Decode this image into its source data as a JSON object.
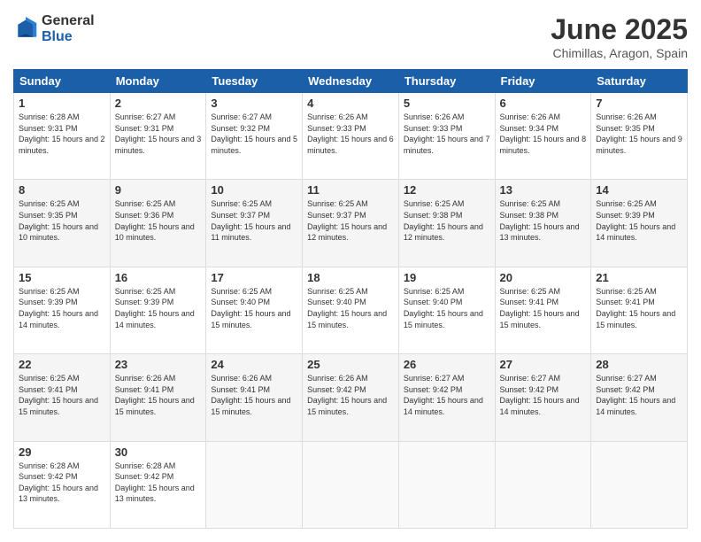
{
  "logo": {
    "general": "General",
    "blue": "Blue"
  },
  "title": "June 2025",
  "location": "Chimillas, Aragon, Spain",
  "days_of_week": [
    "Sunday",
    "Monday",
    "Tuesday",
    "Wednesday",
    "Thursday",
    "Friday",
    "Saturday"
  ],
  "weeks": [
    [
      {
        "day": "1",
        "sunrise": "6:28 AM",
        "sunset": "9:31 PM",
        "daylight": "15 hours and 2 minutes."
      },
      {
        "day": "2",
        "sunrise": "6:27 AM",
        "sunset": "9:31 PM",
        "daylight": "15 hours and 3 minutes."
      },
      {
        "day": "3",
        "sunrise": "6:27 AM",
        "sunset": "9:32 PM",
        "daylight": "15 hours and 5 minutes."
      },
      {
        "day": "4",
        "sunrise": "6:26 AM",
        "sunset": "9:33 PM",
        "daylight": "15 hours and 6 minutes."
      },
      {
        "day": "5",
        "sunrise": "6:26 AM",
        "sunset": "9:33 PM",
        "daylight": "15 hours and 7 minutes."
      },
      {
        "day": "6",
        "sunrise": "6:26 AM",
        "sunset": "9:34 PM",
        "daylight": "15 hours and 8 minutes."
      },
      {
        "day": "7",
        "sunrise": "6:26 AM",
        "sunset": "9:35 PM",
        "daylight": "15 hours and 9 minutes."
      }
    ],
    [
      {
        "day": "8",
        "sunrise": "6:25 AM",
        "sunset": "9:35 PM",
        "daylight": "15 hours and 10 minutes."
      },
      {
        "day": "9",
        "sunrise": "6:25 AM",
        "sunset": "9:36 PM",
        "daylight": "15 hours and 10 minutes."
      },
      {
        "day": "10",
        "sunrise": "6:25 AM",
        "sunset": "9:37 PM",
        "daylight": "15 hours and 11 minutes."
      },
      {
        "day": "11",
        "sunrise": "6:25 AM",
        "sunset": "9:37 PM",
        "daylight": "15 hours and 12 minutes."
      },
      {
        "day": "12",
        "sunrise": "6:25 AM",
        "sunset": "9:38 PM",
        "daylight": "15 hours and 12 minutes."
      },
      {
        "day": "13",
        "sunrise": "6:25 AM",
        "sunset": "9:38 PM",
        "daylight": "15 hours and 13 minutes."
      },
      {
        "day": "14",
        "sunrise": "6:25 AM",
        "sunset": "9:39 PM",
        "daylight": "15 hours and 14 minutes."
      }
    ],
    [
      {
        "day": "15",
        "sunrise": "6:25 AM",
        "sunset": "9:39 PM",
        "daylight": "15 hours and 14 minutes."
      },
      {
        "day": "16",
        "sunrise": "6:25 AM",
        "sunset": "9:39 PM",
        "daylight": "15 hours and 14 minutes."
      },
      {
        "day": "17",
        "sunrise": "6:25 AM",
        "sunset": "9:40 PM",
        "daylight": "15 hours and 15 minutes."
      },
      {
        "day": "18",
        "sunrise": "6:25 AM",
        "sunset": "9:40 PM",
        "daylight": "15 hours and 15 minutes."
      },
      {
        "day": "19",
        "sunrise": "6:25 AM",
        "sunset": "9:40 PM",
        "daylight": "15 hours and 15 minutes."
      },
      {
        "day": "20",
        "sunrise": "6:25 AM",
        "sunset": "9:41 PM",
        "daylight": "15 hours and 15 minutes."
      },
      {
        "day": "21",
        "sunrise": "6:25 AM",
        "sunset": "9:41 PM",
        "daylight": "15 hours and 15 minutes."
      }
    ],
    [
      {
        "day": "22",
        "sunrise": "6:25 AM",
        "sunset": "9:41 PM",
        "daylight": "15 hours and 15 minutes."
      },
      {
        "day": "23",
        "sunrise": "6:26 AM",
        "sunset": "9:41 PM",
        "daylight": "15 hours and 15 minutes."
      },
      {
        "day": "24",
        "sunrise": "6:26 AM",
        "sunset": "9:41 PM",
        "daylight": "15 hours and 15 minutes."
      },
      {
        "day": "25",
        "sunrise": "6:26 AM",
        "sunset": "9:42 PM",
        "daylight": "15 hours and 15 minutes."
      },
      {
        "day": "26",
        "sunrise": "6:27 AM",
        "sunset": "9:42 PM",
        "daylight": "15 hours and 14 minutes."
      },
      {
        "day": "27",
        "sunrise": "6:27 AM",
        "sunset": "9:42 PM",
        "daylight": "15 hours and 14 minutes."
      },
      {
        "day": "28",
        "sunrise": "6:27 AM",
        "sunset": "9:42 PM",
        "daylight": "15 hours and 14 minutes."
      }
    ],
    [
      {
        "day": "29",
        "sunrise": "6:28 AM",
        "sunset": "9:42 PM",
        "daylight": "15 hours and 13 minutes."
      },
      {
        "day": "30",
        "sunrise": "6:28 AM",
        "sunset": "9:42 PM",
        "daylight": "15 hours and 13 minutes."
      },
      null,
      null,
      null,
      null,
      null
    ]
  ]
}
